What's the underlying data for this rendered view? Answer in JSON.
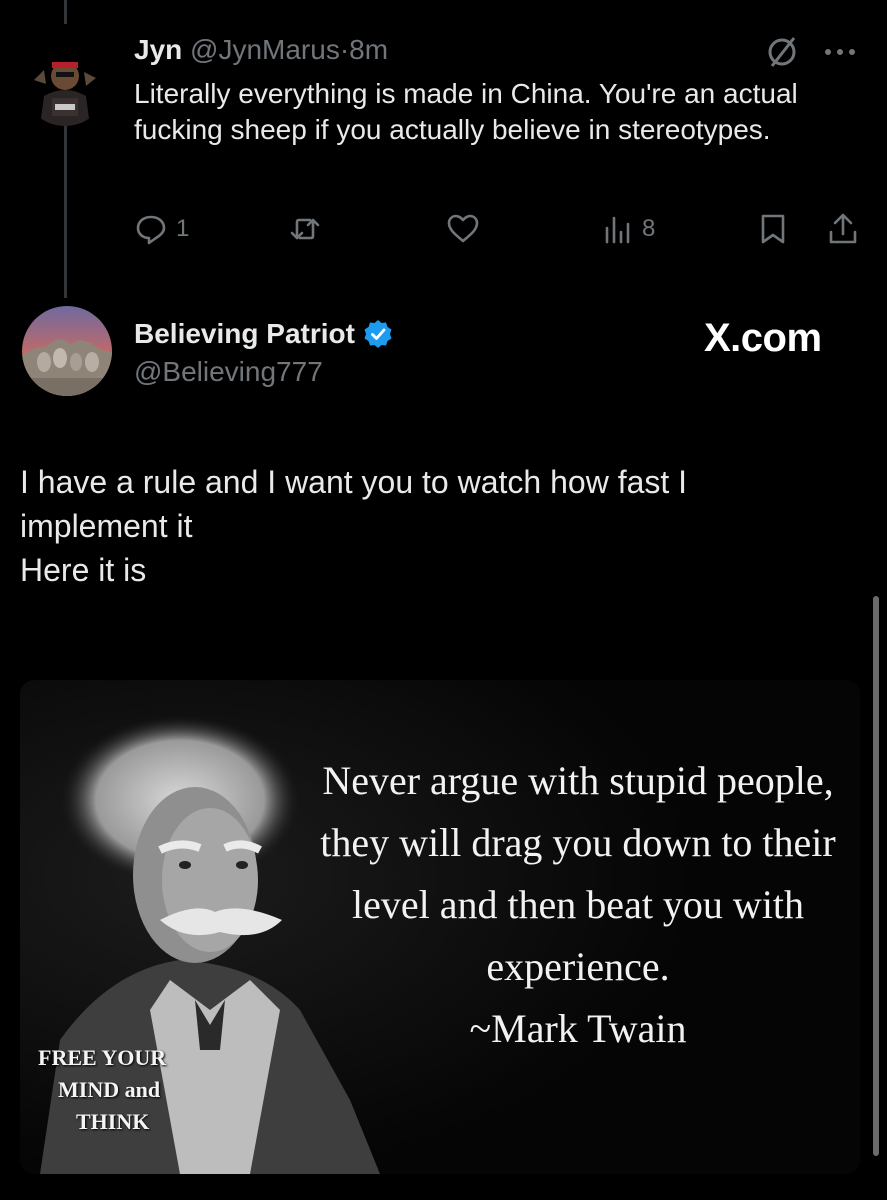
{
  "reply": {
    "name": "Jyn",
    "handle": "@JynMarus",
    "dot": "·",
    "time": "8m",
    "text": "Literally everything is made in China. You're an actual fucking sheep if you actually believe in stereotypes.",
    "reply_count": "1",
    "views_count": "8"
  },
  "post": {
    "name": "Believing Patriot",
    "handle": "@Believing777",
    "watermark": "X.com",
    "lines": [
      "I have a rule and I want you to watch how fast I implement it",
      "Here it is"
    ]
  },
  "meme": {
    "quote": "Never argue with stupid people, they will drag you down to their level and then beat you with experience.",
    "author": "~Mark Twain",
    "caption_lines": [
      "FREE YOUR",
      "MIND and",
      "THINK"
    ]
  },
  "colors": {
    "background": "#000000",
    "text": "#e7e9ea",
    "muted": "#71767b",
    "verified": "#1d9bf0"
  },
  "icons": [
    "grok-icon",
    "more-icon",
    "reply-icon",
    "repost-icon",
    "like-icon",
    "views-icon",
    "bookmark-icon",
    "share-icon",
    "verified-icon"
  ]
}
